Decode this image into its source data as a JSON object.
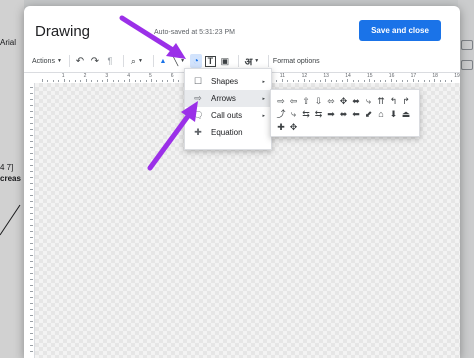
{
  "background_doc": {
    "font_label": "Arial",
    "fragment_1": "4 7]",
    "fragment_2": "creas"
  },
  "dialog": {
    "title": "Drawing",
    "autosave": "Auto-saved at 5:31:23 PM",
    "save_button": "Save and close"
  },
  "toolbar": {
    "actions_label": "Actions",
    "undo_icon": "↶",
    "redo_icon": "↷",
    "paint_format_icon": "¶",
    "zoom_icon": "⌕",
    "select_icon": "▲",
    "line_icon": "╲",
    "shape_icon": "◔",
    "textbox_icon": "T",
    "image_icon": "▣",
    "wordart_icon": "अ",
    "format_options_label": "Format options"
  },
  "ruler": {
    "numbers": [
      "1",
      "2",
      "3",
      "4",
      "5",
      "6",
      "7",
      "8",
      "9",
      "10",
      "11",
      "12",
      "13",
      "14",
      "15",
      "16",
      "17",
      "18",
      "19"
    ]
  },
  "shape_menu": {
    "items": [
      {
        "label": "Shapes",
        "icon": "shapes-icon",
        "glyph": "☐"
      },
      {
        "label": "Arrows",
        "icon": "arrow-icon",
        "glyph": "⇨"
      },
      {
        "label": "Call outs",
        "icon": "callout-icon",
        "glyph": "🗨"
      },
      {
        "label": "Equation",
        "icon": "equation-icon",
        "glyph": "✚"
      }
    ],
    "submenu_chevron": "▸"
  },
  "arrows_submenu": {
    "glyphs": [
      "⇨",
      "⇦",
      "⇧",
      "⇩",
      "⬄",
      "✥",
      "⬌",
      "⤷",
      "⇈",
      "↰",
      "↱",
      "⤴",
      "⤷",
      "⇆",
      "⇆",
      "➡",
      "⬌",
      "⬅",
      "⬋",
      "⌂",
      "⬇",
      "⏏",
      "✚",
      "✥"
    ]
  },
  "colors": {
    "accent": "#1a73e8",
    "annotation_arrow": "#9b30e8",
    "menu_highlight": "#e8eaed"
  }
}
